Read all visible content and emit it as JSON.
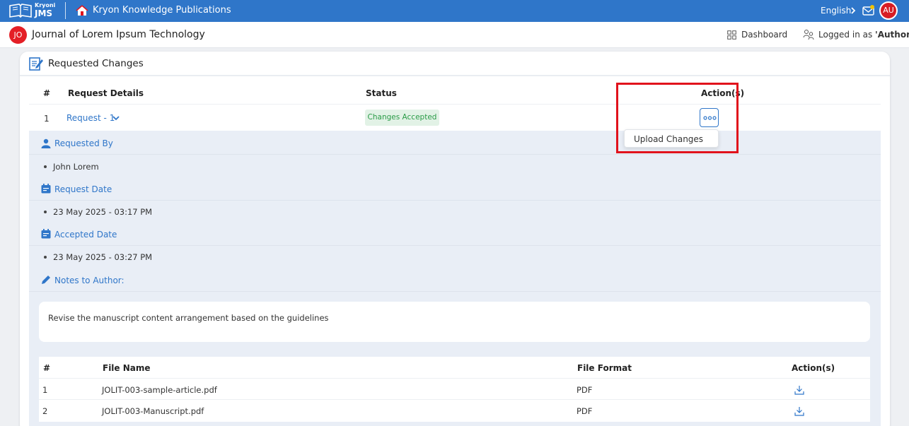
{
  "topbar": {
    "logo_small": "Kryoni",
    "logo_big": "JMS",
    "publisher": "Kryon Knowledge Publications",
    "language": "English",
    "user_initials": "AU"
  },
  "subbar": {
    "journal_initials": "JO",
    "journal_title": "Journal of Lorem Ipsum Technology",
    "dashboard_label": "Dashboard",
    "logged_in_prefix": "Logged in as ",
    "logged_in_role": "'Author'"
  },
  "card": {
    "title": "Requested Changes",
    "headers": {
      "num": "#",
      "details": "Request Details",
      "status": "Status",
      "actions": "Action(s)"
    },
    "request": {
      "num": "1",
      "label": "Request - 1",
      "status": "Changes Accepted"
    },
    "dropdown": {
      "upload_label": "Upload Changes"
    },
    "details": {
      "requested_by_label": "Requested By",
      "requested_by_value": "John Lorem",
      "request_date_label": "Request Date",
      "request_date_value": "23 May 2025 - 03:17 PM",
      "accepted_date_label": "Accepted Date",
      "accepted_date_value": "23 May 2025 - 03:27 PM",
      "notes_label": "Notes to Author:",
      "notes_value": "Revise the manuscript content arrangement based on the guidelines"
    },
    "files": {
      "headers": {
        "num": "#",
        "name": "File Name",
        "format": "File Format",
        "actions": "Action(s)"
      },
      "rows": [
        {
          "num": "1",
          "name": "JOLIT-003-sample-article.pdf",
          "format": "PDF"
        },
        {
          "num": "2",
          "name": "JOLIT-003-Manuscript.pdf",
          "format": "PDF"
        }
      ]
    }
  },
  "colors": {
    "primary": "#2f76c9",
    "highlight": "#e1121c",
    "badge_bg": "#e2f2e6",
    "badge_text": "#2a9b47",
    "panel_bg": "#e9eef6"
  },
  "icons": [
    "book-logo-icon",
    "home-icon",
    "chevron-right-icon",
    "mail-icon",
    "dashboard-grid-icon",
    "user-group-icon",
    "edit-document-icon",
    "chevron-down-icon",
    "more-dots-icon",
    "user-icon",
    "calendar-icon",
    "pencil-icon",
    "download-icon"
  ]
}
